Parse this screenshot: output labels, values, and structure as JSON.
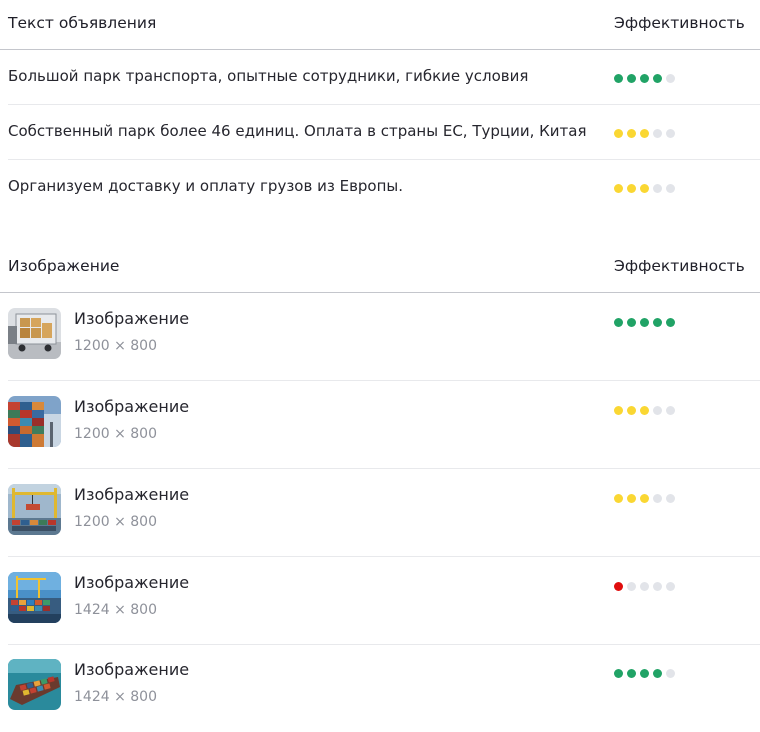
{
  "text_section": {
    "header": "Текст объявления",
    "effectiveness_header": "Эффективность",
    "rows": [
      {
        "text": "Большой парк транспорта, опытные сотрудники, гибкие условия",
        "score": 4,
        "color": "#21a366"
      },
      {
        "text": "Собственный парк более 46 единиц. Оплата в страны ЕС, Турции, Китая",
        "score": 3,
        "color": "#fad733"
      },
      {
        "text": "Организуем доставку и оплату грузов из Европы.",
        "score": 3,
        "color": "#fad733"
      }
    ]
  },
  "image_section": {
    "header": "Изображение",
    "effectiveness_header": "Эффективность",
    "rows": [
      {
        "title": "Изображение",
        "size": "1200 × 800",
        "score": 5,
        "color": "#21a366",
        "thumb": "truck"
      },
      {
        "title": "Изображение",
        "size": "1200 × 800",
        "score": 3,
        "color": "#fad733",
        "thumb": "containers"
      },
      {
        "title": "Изображение",
        "size": "1200 × 800",
        "score": 3,
        "color": "#fad733",
        "thumb": "crane"
      },
      {
        "title": "Изображение",
        "size": "1424 × 800",
        "score": 1,
        "color": "#e00d0d",
        "thumb": "port"
      },
      {
        "title": "Изображение",
        "size": "1424 × 800",
        "score": 4,
        "color": "#21a366",
        "thumb": "ship"
      }
    ]
  },
  "inactive_dot_color": "#e2e4e9"
}
